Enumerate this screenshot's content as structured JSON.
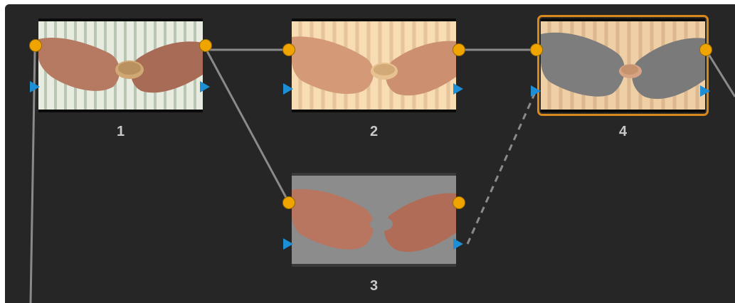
{
  "nodes": [
    {
      "id": "1",
      "label": "1",
      "type": "original"
    },
    {
      "id": "2",
      "label": "2",
      "type": "warm-grade"
    },
    {
      "id": "3",
      "label": "3",
      "type": "key-matte"
    },
    {
      "id": "4",
      "label": "4",
      "type": "composite",
      "selected": true
    }
  ],
  "connections": [
    {
      "from": "1",
      "to": "2",
      "kind": "rgb",
      "style": "solid"
    },
    {
      "from": "1",
      "to": "3",
      "kind": "rgb",
      "style": "solid"
    },
    {
      "from": "2",
      "to": "4",
      "kind": "rgb",
      "style": "solid"
    },
    {
      "from": "3",
      "to": "4",
      "kind": "key",
      "style": "dashed"
    }
  ],
  "colors": {
    "background": "#262626",
    "rgb_port": "#f0a400",
    "key_port": "#1c8fd6",
    "wire": "#8a8a8a",
    "selected_outline": "#d9891c",
    "label": "#c8c8c8"
  },
  "icons": {
    "rgb_port": "orange-circle-icon",
    "key_port": "blue-triangle-icon"
  }
}
